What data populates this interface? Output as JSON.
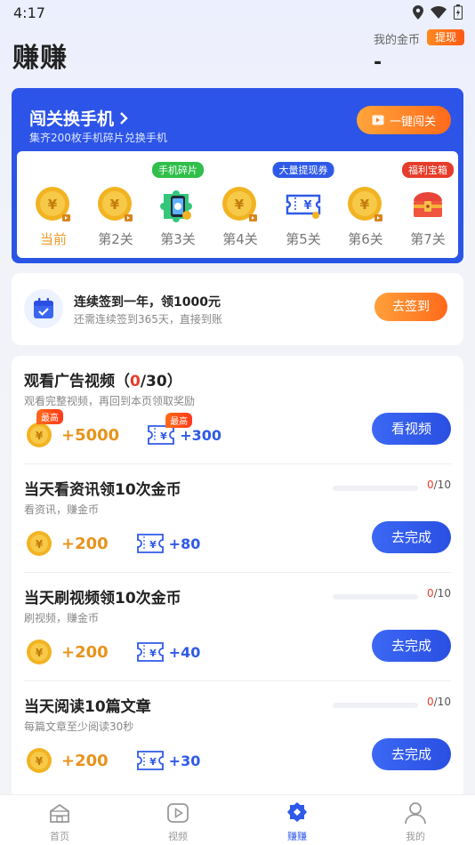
{
  "status_bar": {
    "time": "4:17"
  },
  "header": {
    "title": "赚赚",
    "coin_label": "我的金币",
    "withdraw_label": "提现",
    "coin_value": "-"
  },
  "level_card": {
    "title": "闯关换手机",
    "subtitle": "集齐200枚手机碎片兑换手机",
    "one_key_label": "一键闯关",
    "levels": [
      {
        "label": "当前",
        "tag": "",
        "type": "coin"
      },
      {
        "label": "第2关",
        "tag": "",
        "type": "coin"
      },
      {
        "label": "第3关",
        "tag": "手机碎片",
        "type": "phone"
      },
      {
        "label": "第4关",
        "tag": "",
        "type": "coin"
      },
      {
        "label": "第5关",
        "tag": "大量提现券",
        "type": "ticket"
      },
      {
        "label": "第6关",
        "tag": "",
        "type": "coin"
      },
      {
        "label": "第7关",
        "tag": "福利宝箱",
        "type": "chest"
      }
    ]
  },
  "sign_card": {
    "title": "连续签到一年，领1000元",
    "subtitle": "还需连续签到365天，直接到账",
    "button": "去签到"
  },
  "tasks": [
    {
      "title_prefix": "观看广告视频（",
      "title_count": "0",
      "title_suffix": "/30）",
      "subtitle": "观看完整视频，再回到本页领取奖励",
      "coin_reward": "+5000",
      "ticket_reward": "+300",
      "tag": "最高",
      "button": "看视频"
    },
    {
      "title": "当天看资讯领10次金币",
      "subtitle": "看资讯，赚金币",
      "progress_done": "0",
      "progress_total": "/10",
      "progress_fraction": 0,
      "coin_reward": "+200",
      "ticket_reward": "+80",
      "button": "去完成"
    },
    {
      "title": "当天刷视频领10次金币",
      "subtitle": "刷视频，赚金币",
      "progress_done": "0",
      "progress_total": "/10",
      "progress_fraction": 0,
      "coin_reward": "+200",
      "ticket_reward": "+40",
      "button": "去完成"
    },
    {
      "title": "当天阅读10篇文章",
      "subtitle": "每篇文章至少阅读30秒",
      "progress_done": "0",
      "progress_total": "/10",
      "progress_fraction": 0,
      "coin_reward": "+200",
      "ticket_reward": "+30",
      "button": "去完成"
    }
  ],
  "bottom_nav": [
    {
      "label": "首页",
      "icon": "home-icon",
      "active": false
    },
    {
      "label": "视频",
      "icon": "video-icon",
      "active": false
    },
    {
      "label": "赚赚",
      "icon": "earn-icon",
      "active": true
    },
    {
      "label": "我的",
      "icon": "profile-icon",
      "active": false
    }
  ],
  "colors": {
    "primary": "#2f5ae8",
    "orange": "#ff6a1a",
    "coin": "#f2b322",
    "red": "#e63c2a"
  }
}
